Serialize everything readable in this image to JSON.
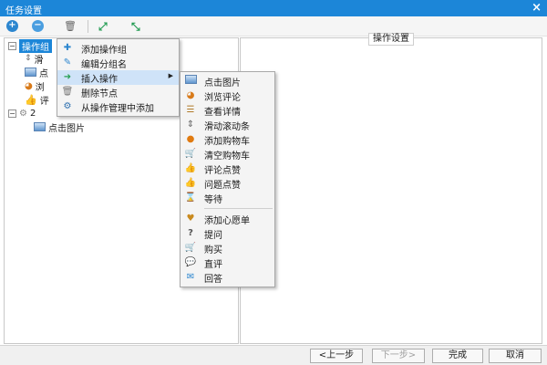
{
  "window": {
    "title": "任务设置",
    "close_glyph": "×"
  },
  "toolbar": {
    "buttons": [
      {
        "name": "add-icon",
        "glyph": "+"
      },
      {
        "name": "minus-icon",
        "glyph": "−"
      },
      {
        "name": "delete-icon",
        "glyph": "🗑"
      },
      {
        "name": "expand-all-icon",
        "glyph": "⤢"
      },
      {
        "name": "collapse-all-icon",
        "glyph": "⤡"
      }
    ]
  },
  "tree": {
    "root_label": "操作组",
    "child_labels": [
      "滑",
      "点",
      "浏",
      "评"
    ],
    "group2_label": "2",
    "group2_child": "点击图片"
  },
  "right_panel": {
    "title": "操作设置"
  },
  "context_menu": {
    "items": [
      {
        "label": "添加操作组",
        "icon": "add-group-icon",
        "glyph": "✚"
      },
      {
        "label": "编辑分组名",
        "icon": "edit-icon",
        "glyph": "✎"
      },
      {
        "label": "插入操作",
        "icon": "insert-icon",
        "glyph": "➜",
        "has_submenu": true
      },
      {
        "label": "删除节点",
        "icon": "trash-icon",
        "glyph": "🗑"
      },
      {
        "label": "从操作管理中添加",
        "icon": "manage-icon",
        "glyph": "⚙"
      }
    ]
  },
  "submenu": {
    "items": [
      {
        "label": "点击图片",
        "icon": "image-icon",
        "glyph": ""
      },
      {
        "label": "浏览评论",
        "icon": "browse-comment-icon",
        "glyph": "◕"
      },
      {
        "label": "查看详情",
        "icon": "details-icon",
        "glyph": "☰"
      },
      {
        "label": "滑动滚动条",
        "icon": "scroll-icon",
        "glyph": "⇕"
      },
      {
        "label": "添加购物车",
        "icon": "add-cart-icon",
        "glyph": "●"
      },
      {
        "label": "清空购物车",
        "icon": "clear-cart-icon",
        "glyph": "🛒"
      },
      {
        "label": "评论点赞",
        "icon": "thumb-up-icon",
        "glyph": "👍"
      },
      {
        "label": "问题点赞",
        "icon": "thumb-up-icon",
        "glyph": "👍"
      },
      {
        "label": "等待",
        "icon": "hourglass-icon",
        "glyph": "⌛"
      },
      {
        "separator": true
      },
      {
        "label": "添加心愿单",
        "icon": "wishlist-icon",
        "glyph": "♥"
      },
      {
        "label": "提问",
        "icon": "ask-icon",
        "glyph": "?"
      },
      {
        "label": "购买",
        "icon": "buy-cart-icon",
        "glyph": "🛒"
      },
      {
        "label": "直评",
        "icon": "comment-bubble-icon",
        "glyph": "💬"
      },
      {
        "label": "回答",
        "icon": "answer-icon",
        "glyph": "✉"
      }
    ]
  },
  "footer": {
    "prev": "<上一步",
    "next": "下一步>",
    "finish": "完成",
    "cancel": "取消"
  },
  "colors": {
    "accent": "#1c86d8",
    "menu_bg": "#f4f4f4",
    "menu_hot": "#cfe3f8"
  }
}
